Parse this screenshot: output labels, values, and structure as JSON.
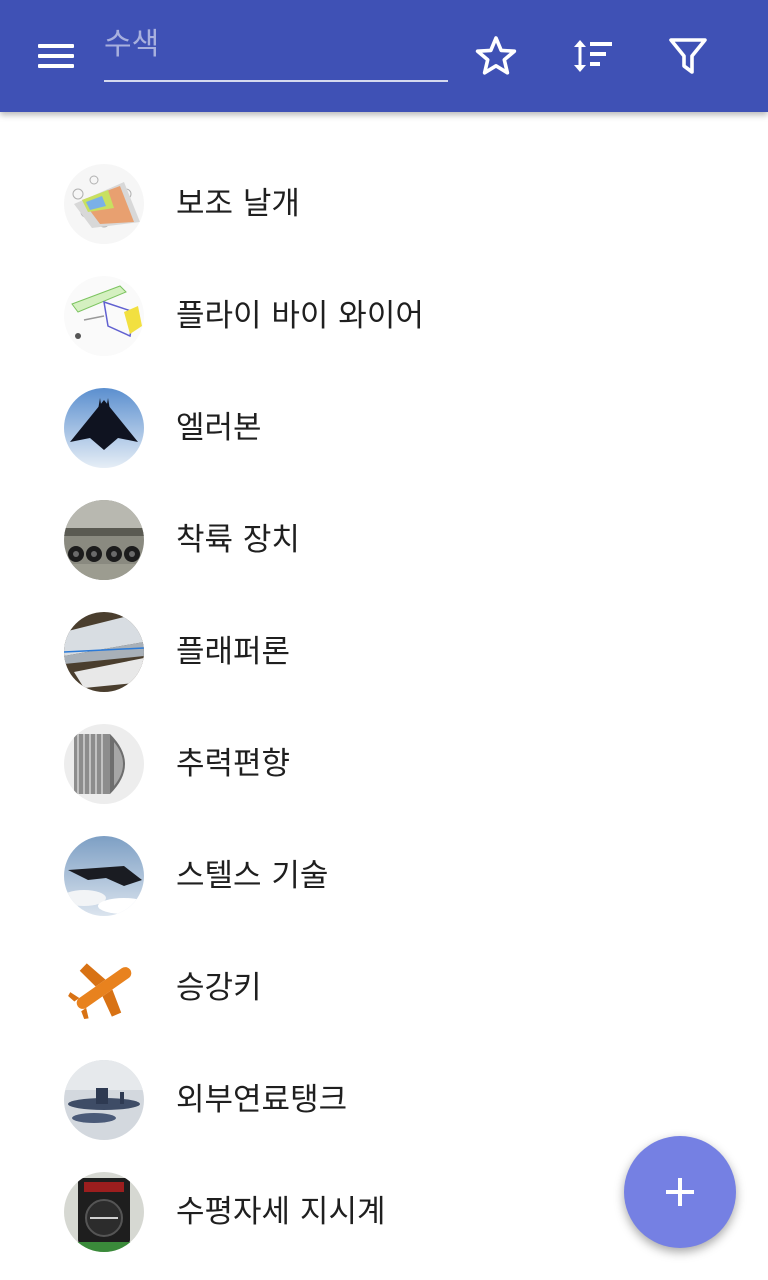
{
  "appbar": {
    "search_placeholder": "수색",
    "search_value": "",
    "icons": {
      "menu": "menu-icon",
      "favorites": "star-outline-icon",
      "sort": "sort-icon",
      "filter": "filter-icon"
    },
    "background": "#3f51b5"
  },
  "list": {
    "items": [
      {
        "label": "보조 날개",
        "icon": "aileron-thumbnail"
      },
      {
        "label": "플라이 바이 와이어",
        "icon": "fly-by-wire-thumbnail"
      },
      {
        "label": "엘러본",
        "icon": "elevon-stealth-jet-thumbnail"
      },
      {
        "label": "착륙 장치",
        "icon": "landing-gear-thumbnail"
      },
      {
        "label": "플래퍼론",
        "icon": "flaperon-wing-thumbnail"
      },
      {
        "label": "추력편향",
        "icon": "thrust-nozzle-thumbnail"
      },
      {
        "label": "스텔스 기술",
        "icon": "stealth-bomber-thumbnail"
      },
      {
        "label": "승강키",
        "icon": "elevator-plane-thumbnail"
      },
      {
        "label": "외부연료탱크",
        "icon": "fuel-tank-jet-thumbnail"
      },
      {
        "label": "수평자세 지시계",
        "icon": "attitude-indicator-thumbnail"
      }
    ]
  },
  "fab": {
    "icon": "plus-icon",
    "color": "#7580e3"
  },
  "colors": {
    "text": "#1f1f1f",
    "background": "#ffffff"
  }
}
